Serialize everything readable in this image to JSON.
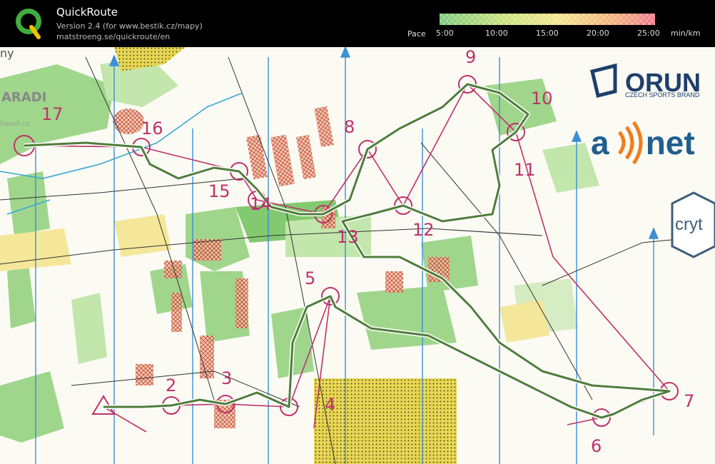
{
  "app": {
    "title": "QuickRoute",
    "version": "Version 2.4  (for www.bestik.cz/mapy)",
    "link": "matstroeng.se/quickroute/en",
    "logo_letter": "Q"
  },
  "pace_legend": {
    "label": "Pace",
    "ticks": [
      "5:00",
      "10:00",
      "15:00",
      "20:00",
      "25:00"
    ],
    "unit": "min/km",
    "colors": [
      "#4caf50",
      "#cddc39",
      "#ffeb3b",
      "#ff9800",
      "#e53935"
    ]
  },
  "map": {
    "controls": [
      "2",
      "3",
      "4",
      "5",
      "6",
      "7",
      "8",
      "9",
      "10",
      "11",
      "12",
      "13",
      "14",
      "15",
      "16",
      "17"
    ],
    "sponsors": {
      "orun": "ORUN",
      "orun_sub": "CZECH SPORTS BRAND",
      "anet": "a    net",
      "cryt": "cryt"
    },
    "map_text": {
      "top_left": "ny",
      "left_mid": "ARADI",
      "left_small": "haradi.cz"
    }
  },
  "colors": {
    "route": "#4f7d3a",
    "course": "#c0306a",
    "north_lines": "#3a8fd6",
    "green": "#5ab84a",
    "yellow": "#f0dc5a"
  }
}
